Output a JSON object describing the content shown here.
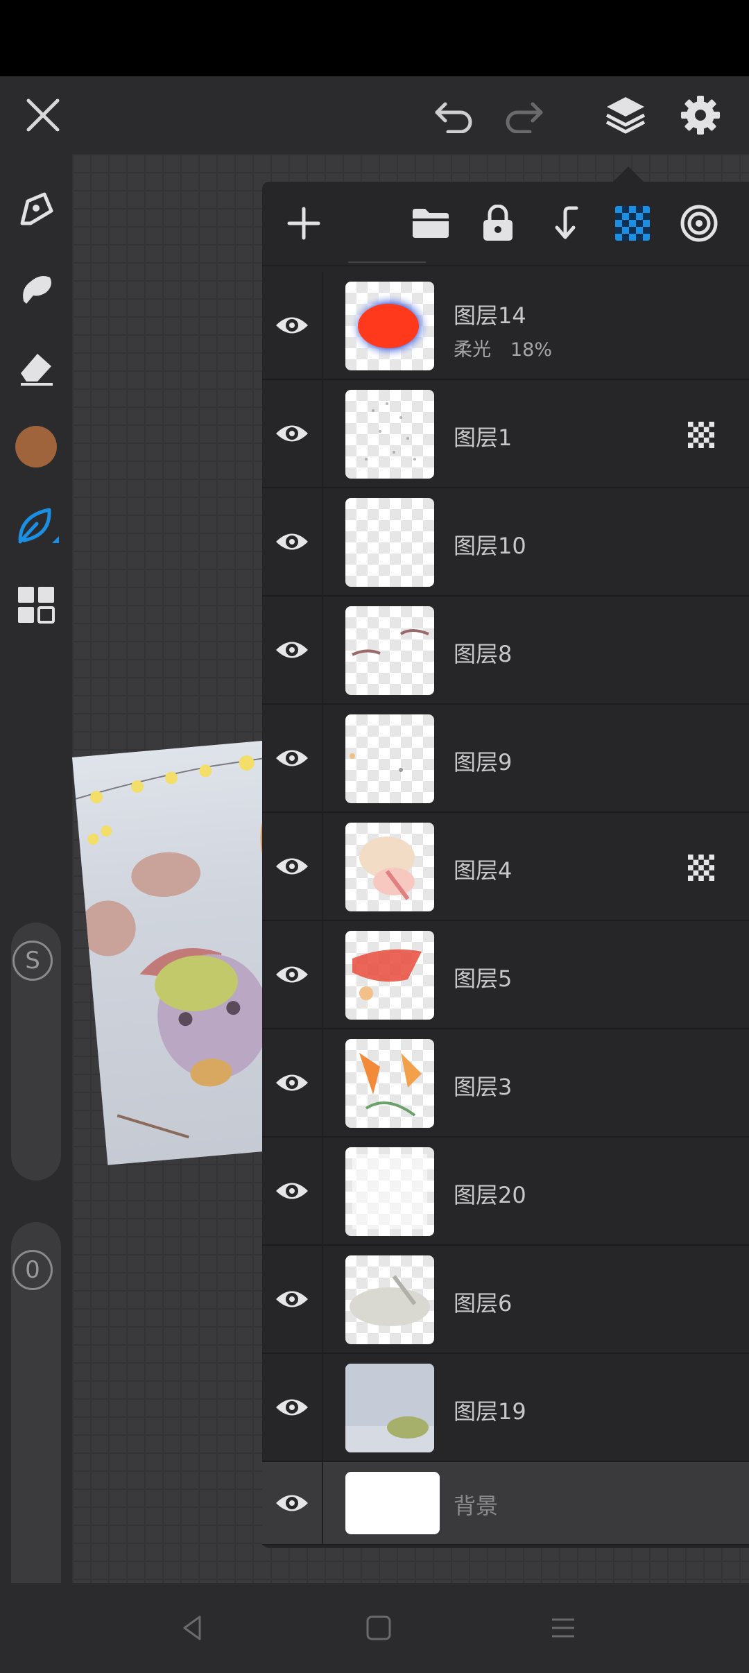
{
  "colors": {
    "accent": "#1a8fe3",
    "current_color": "#a0643c",
    "panel_bg": "#262628",
    "text": "#c8c8ca"
  },
  "toolbar": {
    "icons": [
      "close-icon",
      "undo-icon",
      "redo-icon",
      "layers-icon",
      "settings-icon"
    ]
  },
  "left_tools": {
    "icons": [
      "pen-icon",
      "smudge-icon",
      "eraser-icon",
      "color-swatch",
      "leaf-brush-icon",
      "grid-icon"
    ],
    "size_slider_label": "S",
    "opacity_slider_label": "0"
  },
  "layer_panel": {
    "toolbar_icons": [
      "add-layer-icon",
      "folder-icon",
      "lock-icon",
      "merge-down-icon",
      "alpha-lock-icon",
      "target-icon"
    ],
    "layers": [
      {
        "name": "图层14",
        "blend": "柔光",
        "opacity": "18%",
        "alpha_lock": false
      },
      {
        "name": "图层1",
        "alpha_lock": true
      },
      {
        "name": "图层10",
        "alpha_lock": false
      },
      {
        "name": "图层8",
        "alpha_lock": false
      },
      {
        "name": "图层9",
        "alpha_lock": false
      },
      {
        "name": "图层4",
        "alpha_lock": true
      },
      {
        "name": "图层5",
        "alpha_lock": false
      },
      {
        "name": "图层3",
        "alpha_lock": false
      },
      {
        "name": "图层20",
        "alpha_lock": false
      },
      {
        "name": "图层6",
        "alpha_lock": false
      },
      {
        "name": "图层19",
        "alpha_lock": false
      },
      {
        "name": "背景",
        "alpha_lock": false,
        "selected": true
      }
    ]
  },
  "nav": {
    "icons": [
      "back-icon",
      "home-icon",
      "menu-icon"
    ]
  }
}
